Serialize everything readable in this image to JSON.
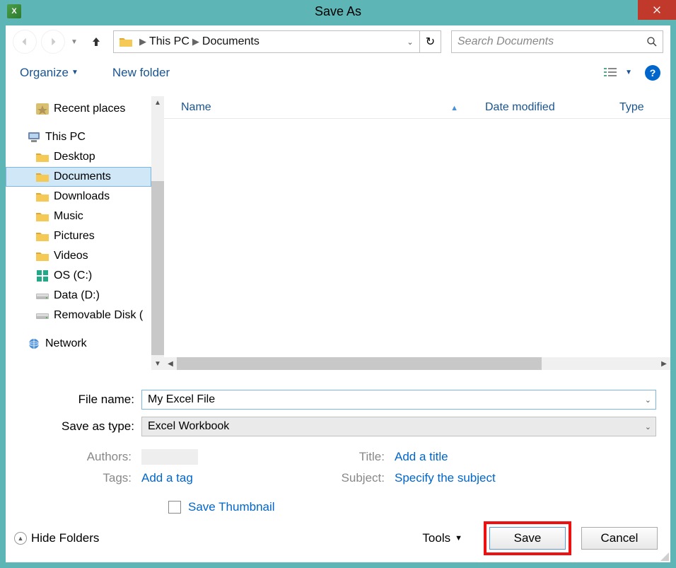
{
  "title": "Save As",
  "breadcrumb": {
    "root": "This PC",
    "current": "Documents"
  },
  "search": {
    "placeholder": "Search Documents"
  },
  "toolbar": {
    "organize": "Organize",
    "new_folder": "New folder"
  },
  "sidebar": {
    "recent_places": "Recent places",
    "this_pc": "This PC",
    "items": [
      "Desktop",
      "Documents",
      "Downloads",
      "Music",
      "Pictures",
      "Videos",
      "OS (C:)",
      "Data (D:)",
      "Removable Disk ("
    ],
    "selected_index": 1,
    "network": "Network"
  },
  "columns": {
    "name": "Name",
    "date": "Date modified",
    "type": "Type"
  },
  "form": {
    "filename_label": "File name:",
    "filename_value": "My Excel File",
    "savetype_label": "Save as type:",
    "savetype_value": "Excel Workbook"
  },
  "meta": {
    "authors_label": "Authors:",
    "tags_label": "Tags:",
    "tags_value": "Add a tag",
    "title_label": "Title:",
    "title_value": "Add a title",
    "subject_label": "Subject:",
    "subject_value": "Specify the subject",
    "save_thumb": "Save Thumbnail"
  },
  "footer": {
    "hide_folders": "Hide Folders",
    "tools": "Tools",
    "save": "Save",
    "cancel": "Cancel"
  }
}
